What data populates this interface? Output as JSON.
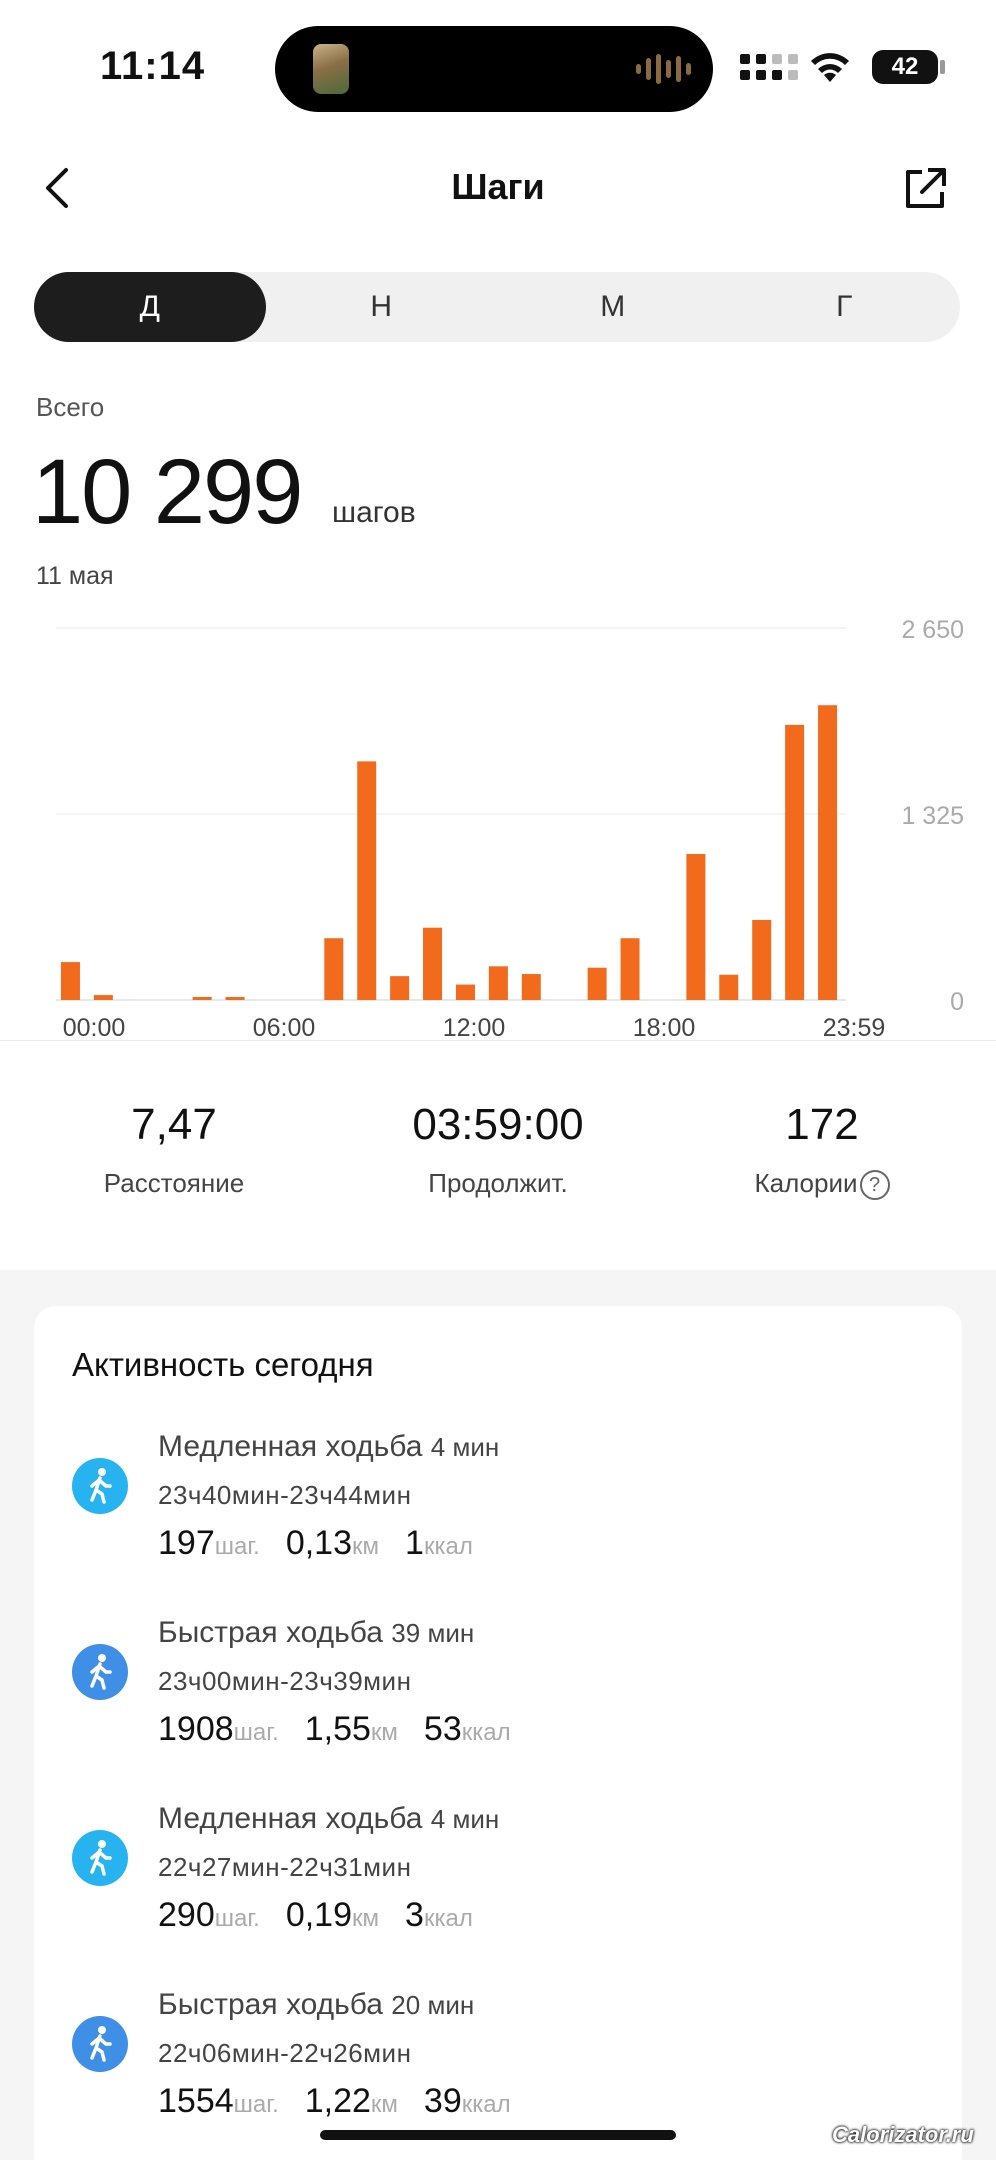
{
  "status_bar": {
    "time": "11:14",
    "battery": "42"
  },
  "nav": {
    "title": "Шаги"
  },
  "segments": [
    {
      "label": "Д",
      "active": true
    },
    {
      "label": "Н",
      "active": false
    },
    {
      "label": "М",
      "active": false
    },
    {
      "label": "Г",
      "active": false
    }
  ],
  "summary": {
    "total_label": "Всего",
    "total_value": "10 299",
    "total_unit": "шагов",
    "date": "11 мая"
  },
  "chart_data": {
    "type": "bar",
    "x_ticks": [
      "00:00",
      "06:00",
      "12:00",
      "18:00",
      "23:59"
    ],
    "y_ticks": [
      "2 650",
      "1 325",
      "0"
    ],
    "ylim": [
      0,
      2650
    ],
    "grid": true,
    "bar_color": "#f26b1d",
    "hours": [
      0,
      1,
      2,
      3,
      4,
      5,
      6,
      7,
      8,
      9,
      10,
      11,
      12,
      13,
      14,
      15,
      16,
      17,
      18,
      19,
      20,
      21,
      22,
      23
    ],
    "values": [
      270,
      35,
      0,
      0,
      8,
      8,
      0,
      0,
      440,
      1700,
      170,
      515,
      110,
      240,
      185,
      0,
      230,
      440,
      0,
      1040,
      180,
      570,
      1960,
      2100
    ]
  },
  "stats": [
    {
      "value": "7,47",
      "label": "Расстояние"
    },
    {
      "value": "03:59:00",
      "label": "Продолжит."
    },
    {
      "value": "172",
      "label": "Калории"
    }
  ],
  "activity": {
    "title": "Активность сегодня",
    "items": [
      {
        "name": "Медленная ходьба",
        "duration": "4 мин",
        "time": "23ч40мин-23ч44мин",
        "steps": "197",
        "steps_unit": "шаг.",
        "distance": "0,13",
        "distance_unit": "км",
        "kcal": "1",
        "kcal_unit": "ккал",
        "icon": "slow-walk-icon",
        "color": "#27b3f0"
      },
      {
        "name": "Быстрая ходьба",
        "duration": "39 мин",
        "time": "23ч00мин-23ч39мин",
        "steps": "1908",
        "steps_unit": "шаг.",
        "distance": "1,55",
        "distance_unit": "км",
        "kcal": "53",
        "kcal_unit": "ккал",
        "icon": "fast-walk-icon",
        "color": "#3f8fe6"
      },
      {
        "name": "Медленная ходьба",
        "duration": "4 мин",
        "time": "22ч27мин-22ч31мин",
        "steps": "290",
        "steps_unit": "шаг.",
        "distance": "0,19",
        "distance_unit": "км",
        "kcal": "3",
        "kcal_unit": "ккал",
        "icon": "slow-walk-icon",
        "color": "#27b3f0"
      },
      {
        "name": "Быстрая ходьба",
        "duration": "20 мин",
        "time": "22ч06мин-22ч26мин",
        "steps": "1554",
        "steps_unit": "шаг.",
        "distance": "1,22",
        "distance_unit": "км",
        "kcal": "39",
        "kcal_unit": "ккал",
        "icon": "fast-walk-icon",
        "color": "#3f8fe6"
      }
    ]
  },
  "watermark": "Calorizator.ru"
}
